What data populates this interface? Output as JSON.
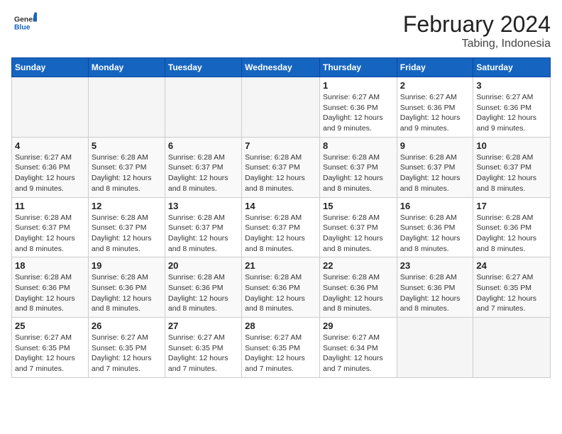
{
  "header": {
    "logo_general": "General",
    "logo_blue": "Blue",
    "title": "February 2024",
    "subtitle": "Tabing, Indonesia"
  },
  "days_of_week": [
    "Sunday",
    "Monday",
    "Tuesday",
    "Wednesday",
    "Thursday",
    "Friday",
    "Saturday"
  ],
  "weeks": [
    [
      {
        "day": "",
        "info": ""
      },
      {
        "day": "",
        "info": ""
      },
      {
        "day": "",
        "info": ""
      },
      {
        "day": "",
        "info": ""
      },
      {
        "day": "1",
        "info": "Sunrise: 6:27 AM\nSunset: 6:36 PM\nDaylight: 12 hours\nand 9 minutes."
      },
      {
        "day": "2",
        "info": "Sunrise: 6:27 AM\nSunset: 6:36 PM\nDaylight: 12 hours\nand 9 minutes."
      },
      {
        "day": "3",
        "info": "Sunrise: 6:27 AM\nSunset: 6:36 PM\nDaylight: 12 hours\nand 9 minutes."
      }
    ],
    [
      {
        "day": "4",
        "info": "Sunrise: 6:27 AM\nSunset: 6:36 PM\nDaylight: 12 hours\nand 9 minutes."
      },
      {
        "day": "5",
        "info": "Sunrise: 6:28 AM\nSunset: 6:37 PM\nDaylight: 12 hours\nand 8 minutes."
      },
      {
        "day": "6",
        "info": "Sunrise: 6:28 AM\nSunset: 6:37 PM\nDaylight: 12 hours\nand 8 minutes."
      },
      {
        "day": "7",
        "info": "Sunrise: 6:28 AM\nSunset: 6:37 PM\nDaylight: 12 hours\nand 8 minutes."
      },
      {
        "day": "8",
        "info": "Sunrise: 6:28 AM\nSunset: 6:37 PM\nDaylight: 12 hours\nand 8 minutes."
      },
      {
        "day": "9",
        "info": "Sunrise: 6:28 AM\nSunset: 6:37 PM\nDaylight: 12 hours\nand 8 minutes."
      },
      {
        "day": "10",
        "info": "Sunrise: 6:28 AM\nSunset: 6:37 PM\nDaylight: 12 hours\nand 8 minutes."
      }
    ],
    [
      {
        "day": "11",
        "info": "Sunrise: 6:28 AM\nSunset: 6:37 PM\nDaylight: 12 hours\nand 8 minutes."
      },
      {
        "day": "12",
        "info": "Sunrise: 6:28 AM\nSunset: 6:37 PM\nDaylight: 12 hours\nand 8 minutes."
      },
      {
        "day": "13",
        "info": "Sunrise: 6:28 AM\nSunset: 6:37 PM\nDaylight: 12 hours\nand 8 minutes."
      },
      {
        "day": "14",
        "info": "Sunrise: 6:28 AM\nSunset: 6:37 PM\nDaylight: 12 hours\nand 8 minutes."
      },
      {
        "day": "15",
        "info": "Sunrise: 6:28 AM\nSunset: 6:37 PM\nDaylight: 12 hours\nand 8 minutes."
      },
      {
        "day": "16",
        "info": "Sunrise: 6:28 AM\nSunset: 6:36 PM\nDaylight: 12 hours\nand 8 minutes."
      },
      {
        "day": "17",
        "info": "Sunrise: 6:28 AM\nSunset: 6:36 PM\nDaylight: 12 hours\nand 8 minutes."
      }
    ],
    [
      {
        "day": "18",
        "info": "Sunrise: 6:28 AM\nSunset: 6:36 PM\nDaylight: 12 hours\nand 8 minutes."
      },
      {
        "day": "19",
        "info": "Sunrise: 6:28 AM\nSunset: 6:36 PM\nDaylight: 12 hours\nand 8 minutes."
      },
      {
        "day": "20",
        "info": "Sunrise: 6:28 AM\nSunset: 6:36 PM\nDaylight: 12 hours\nand 8 minutes."
      },
      {
        "day": "21",
        "info": "Sunrise: 6:28 AM\nSunset: 6:36 PM\nDaylight: 12 hours\nand 8 minutes."
      },
      {
        "day": "22",
        "info": "Sunrise: 6:28 AM\nSunset: 6:36 PM\nDaylight: 12 hours\nand 8 minutes."
      },
      {
        "day": "23",
        "info": "Sunrise: 6:28 AM\nSunset: 6:36 PM\nDaylight: 12 hours\nand 8 minutes."
      },
      {
        "day": "24",
        "info": "Sunrise: 6:27 AM\nSunset: 6:35 PM\nDaylight: 12 hours\nand 7 minutes."
      }
    ],
    [
      {
        "day": "25",
        "info": "Sunrise: 6:27 AM\nSunset: 6:35 PM\nDaylight: 12 hours\nand 7 minutes."
      },
      {
        "day": "26",
        "info": "Sunrise: 6:27 AM\nSunset: 6:35 PM\nDaylight: 12 hours\nand 7 minutes."
      },
      {
        "day": "27",
        "info": "Sunrise: 6:27 AM\nSunset: 6:35 PM\nDaylight: 12 hours\nand 7 minutes."
      },
      {
        "day": "28",
        "info": "Sunrise: 6:27 AM\nSunset: 6:35 PM\nDaylight: 12 hours\nand 7 minutes."
      },
      {
        "day": "29",
        "info": "Sunrise: 6:27 AM\nSunset: 6:34 PM\nDaylight: 12 hours\nand 7 minutes."
      },
      {
        "day": "",
        "info": ""
      },
      {
        "day": "",
        "info": ""
      }
    ]
  ]
}
